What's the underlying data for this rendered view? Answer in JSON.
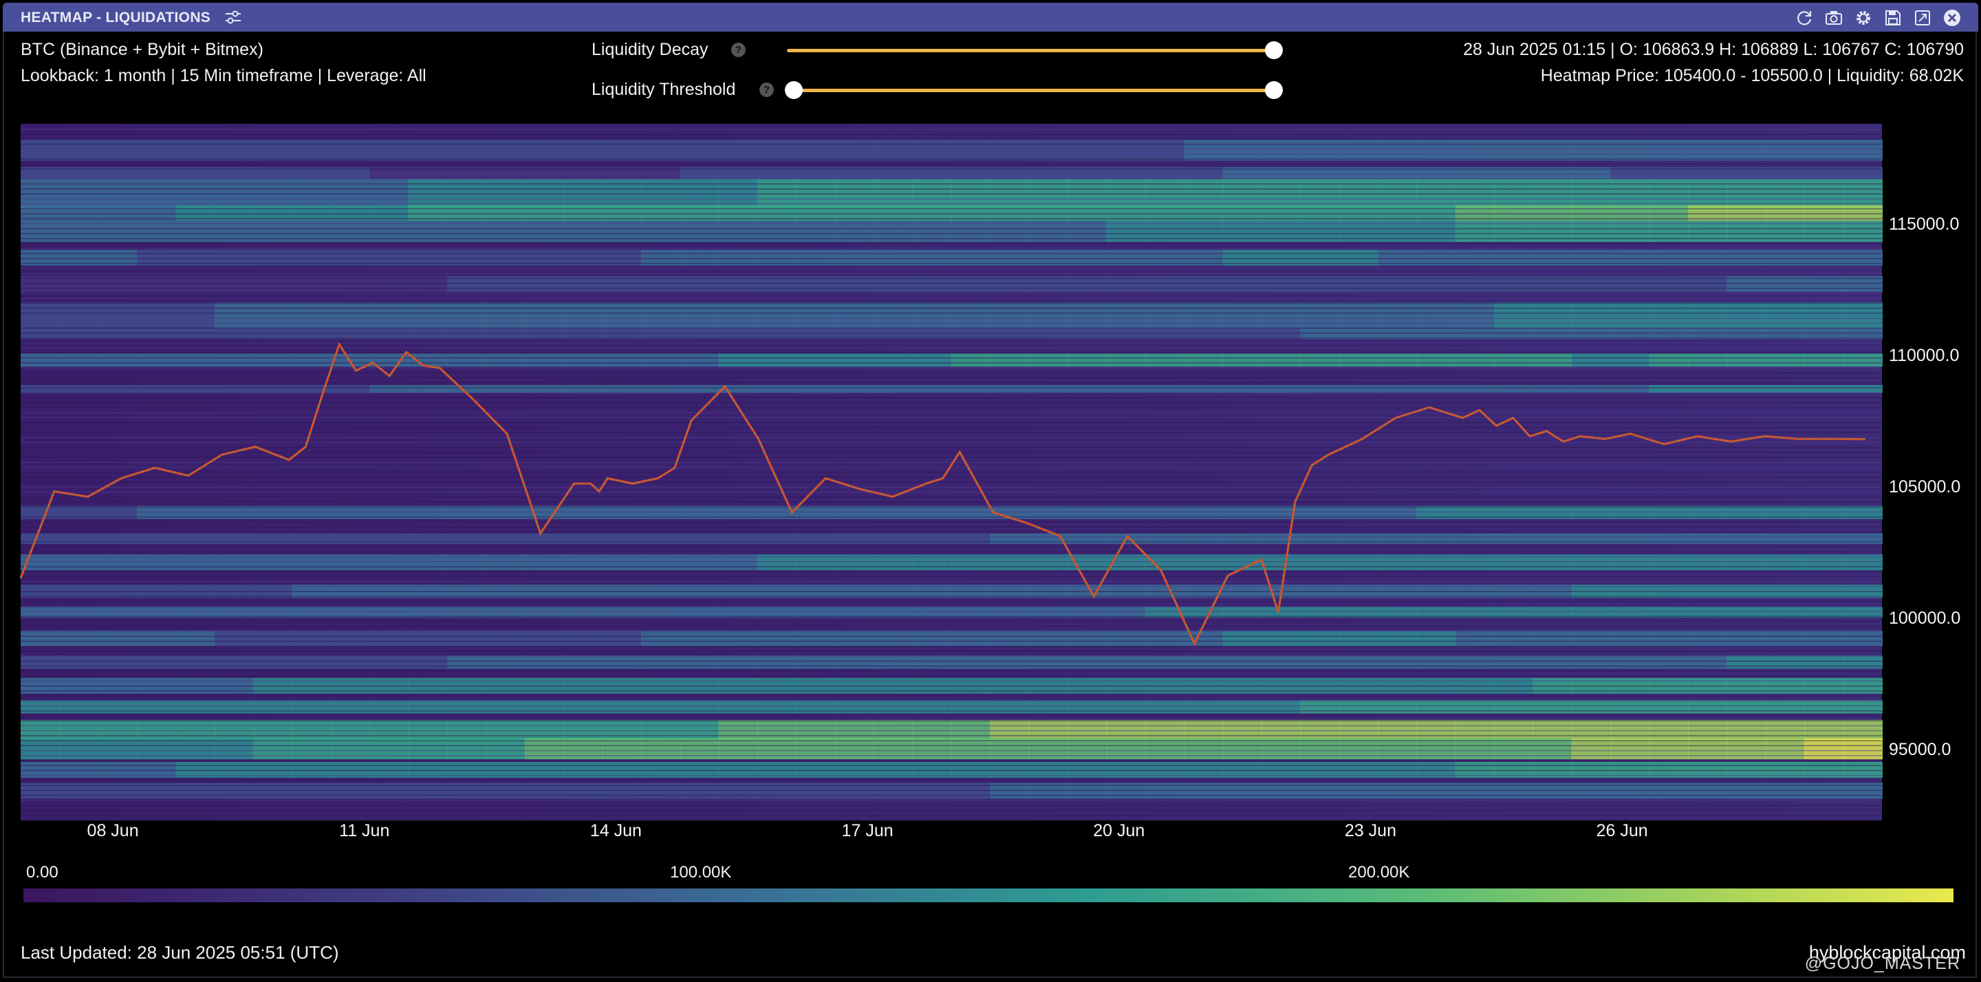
{
  "window": {
    "title": "HEATMAP - LIQUIDATIONS",
    "toolbar_icons": [
      "refresh-icon",
      "camera-icon",
      "gear-icon",
      "save-icon",
      "expand-icon",
      "close-icon"
    ]
  },
  "info": {
    "exchange": "BTC (Binance + Bybit + Bitmex)",
    "lookback": "Lookback: 1 month | 15 Min timeframe | Leverage: All",
    "ohlc": "28 Jun 2025 01:15 | O: 106863.9 H: 106889 L: 106767 C: 106790",
    "heatmap_price": "Heatmap Price: 105400.0 - 105500.0 | Liquidity: 68.02K"
  },
  "controls": {
    "decay_label": "Liquidity Decay",
    "threshold_label": "Liquidity Threshold",
    "decay_value": 1.0,
    "threshold_min": 0.0,
    "threshold_max": 1.0
  },
  "colorbar": {
    "labels": [
      "0.00",
      "100.00K",
      "200.00K"
    ]
  },
  "footer": {
    "updated": "Last Updated: 28 Jun 2025 05:51 (UTC)",
    "brand": "hyblockcapital.com",
    "watermark": "@GOJO_MASTER"
  },
  "colors": {
    "accent": "#f0b54a",
    "title_bar": "#4a4f9c",
    "candle_up": "#3fae49",
    "candle_down": "#e0452f"
  },
  "chart_data": {
    "type": "heatmap",
    "x_ticks": [
      "08 Jun",
      "11 Jun",
      "14 Jun",
      "17 Jun",
      "20 Jun",
      "23 Jun",
      "26 Jun"
    ],
    "y_ticks": [
      115000,
      110000,
      105000,
      100000,
      95000
    ],
    "y_tick_labels": [
      "115000.0",
      "110000.0",
      "105000.0",
      "100000.0",
      "95000.0"
    ],
    "ylim": [
      92300,
      118800
    ],
    "xlim_days": [
      0,
      22.2
    ],
    "price_series": {
      "day": [
        0,
        0.4,
        0.8,
        1.2,
        1.6,
        2.0,
        2.4,
        2.8,
        3.2,
        3.4,
        3.6,
        3.8,
        4.0,
        4.2,
        4.4,
        4.6,
        4.8,
        5.0,
        5.4,
        5.8,
        6.2,
        6.6,
        6.8,
        6.9,
        7.0,
        7.3,
        7.6,
        7.8,
        8.0,
        8.4,
        8.8,
        9.2,
        9.6,
        10.0,
        10.4,
        10.8,
        11.0,
        11.2,
        11.6,
        12.0,
        12.4,
        12.8,
        13.2,
        13.6,
        14.0,
        14.4,
        14.8,
        15.0,
        15.2,
        15.4,
        15.6,
        16.0,
        16.4,
        16.8,
        17.2,
        17.4,
        17.6,
        17.8,
        18.0,
        18.2,
        18.4,
        18.6,
        18.9,
        19.2,
        19.6,
        20.0,
        20.4,
        20.8,
        21.2,
        21.6,
        22.0
      ],
      "price": [
        101500,
        104800,
        104600,
        105300,
        105700,
        105400,
        106200,
        106500,
        106000,
        106500,
        108500,
        110400,
        109400,
        109700,
        109200,
        110100,
        109600,
        109500,
        108300,
        107000,
        103200,
        105100,
        105100,
        104800,
        105300,
        105100,
        105300,
        105700,
        107500,
        108800,
        106800,
        104000,
        105300,
        104900,
        104600,
        105100,
        105300,
        106300,
        104000,
        103600,
        103100,
        100800,
        103100,
        101800,
        99000,
        101600,
        102200,
        100200,
        104400,
        105800,
        106200,
        106800,
        107600,
        108000,
        107600,
        107900,
        107300,
        107600,
        106900,
        107100,
        106700,
        106900,
        106800,
        107000,
        106600,
        106900,
        106700,
        106900,
        106800,
        106800,
        106790
      ]
    }
  }
}
